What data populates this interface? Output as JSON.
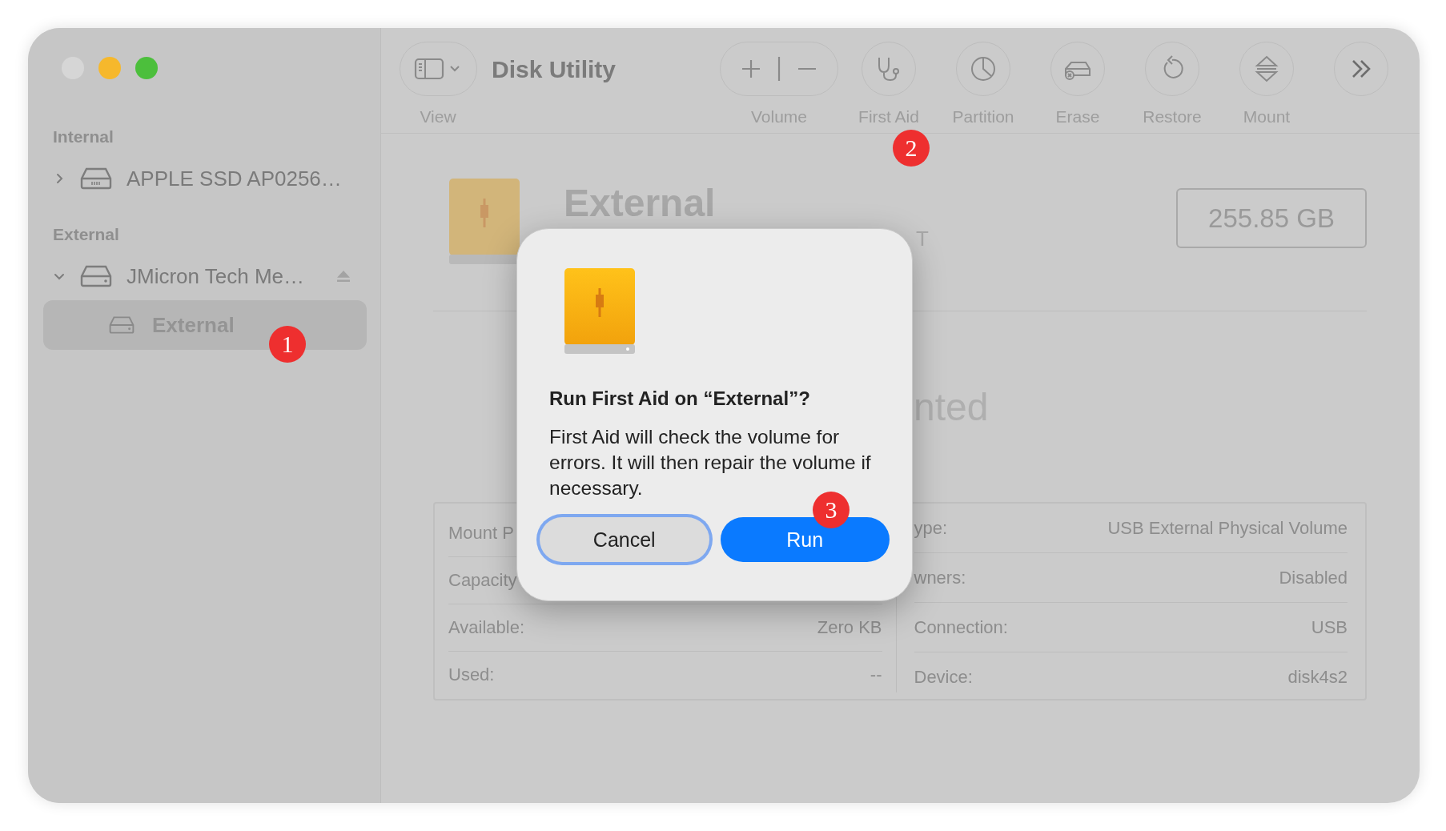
{
  "window": {
    "controls": [
      {
        "kind": "close"
      },
      {
        "kind": "minimize"
      },
      {
        "kind": "zoom"
      }
    ]
  },
  "toolbar": {
    "view_label": "View",
    "title": "Disk Utility",
    "tools": [
      {
        "kind": "volume",
        "label": "Volume"
      },
      {
        "kind": "first_aid",
        "label": "First Aid"
      },
      {
        "kind": "partition",
        "label": "Partition"
      },
      {
        "kind": "erase",
        "label": "Erase"
      },
      {
        "kind": "restore",
        "label": "Restore"
      },
      {
        "kind": "mount",
        "label": "Mount"
      },
      {
        "kind": "more"
      }
    ]
  },
  "sidebar": {
    "sections": [
      {
        "heading": "Internal",
        "items": [
          {
            "name": "APPLE SSD AP0256…",
            "kind": "internal",
            "expanded": false,
            "selected": false
          }
        ]
      },
      {
        "heading": "External",
        "items": [
          {
            "name": "JMicron Tech Me…",
            "kind": "external",
            "expanded": true,
            "ejectable": true,
            "selected": false,
            "children": [
              {
                "name": "External",
                "selected": true
              }
            ]
          }
        ]
      }
    ]
  },
  "volume": {
    "name": "External",
    "subtitle": "T",
    "capacity": "255.85 GB",
    "status": "nted"
  },
  "info": {
    "left": [
      {
        "label": "Mount P"
      },
      {
        "label": "Capacity"
      },
      {
        "label": "Available:",
        "value": "Zero KB"
      },
      {
        "label": "Used:",
        "value": "--"
      }
    ],
    "right": [
      {
        "label": "ype:",
        "value": "USB External Physical Volume"
      },
      {
        "label": "wners:",
        "value": "Disabled"
      },
      {
        "label": "Connection:",
        "value": "USB"
      },
      {
        "label": "Device:",
        "value": "disk4s2"
      }
    ]
  },
  "dialog": {
    "title": "Run First Aid on “External”?",
    "message": "First Aid will check the volume for errors. It will then repair the volume if necessary.",
    "buttons": [
      {
        "kind": "cancel",
        "label": "Cancel"
      },
      {
        "kind": "default",
        "label": "Run"
      }
    ]
  },
  "annotations": [
    {
      "label": "1"
    },
    {
      "label": "2"
    },
    {
      "label": "3"
    }
  ]
}
